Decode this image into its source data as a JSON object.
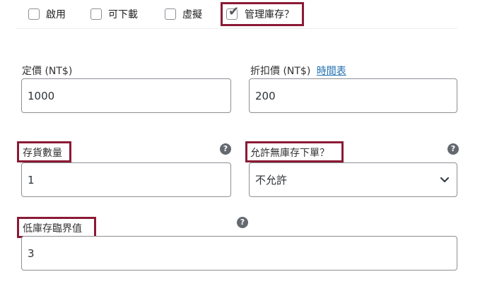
{
  "checkboxes": [
    {
      "label": "啟用",
      "checked": false
    },
    {
      "label": "可下載",
      "checked": false
    },
    {
      "label": "虛擬",
      "checked": false
    },
    {
      "label": "管理庫存？",
      "checked": true
    }
  ],
  "pricing": {
    "regular_label": "定價 (NT$)",
    "regular_value": "1000",
    "sale_label": "折扣價 (NT$)",
    "sale_schedule_link": "時間表",
    "sale_value": "200"
  },
  "inventory": {
    "stock_qty_label": "存貨數量",
    "stock_qty_value": "1",
    "backorders_label": "允許無庫存下單？",
    "backorders_value": "不允許",
    "low_stock_label": "低庫存臨界值",
    "low_stock_value": "3"
  },
  "help_glyph": "?",
  "colors": {
    "highlight": "#8b1a35",
    "link": "#2271b1",
    "help_icon": "#646970"
  }
}
